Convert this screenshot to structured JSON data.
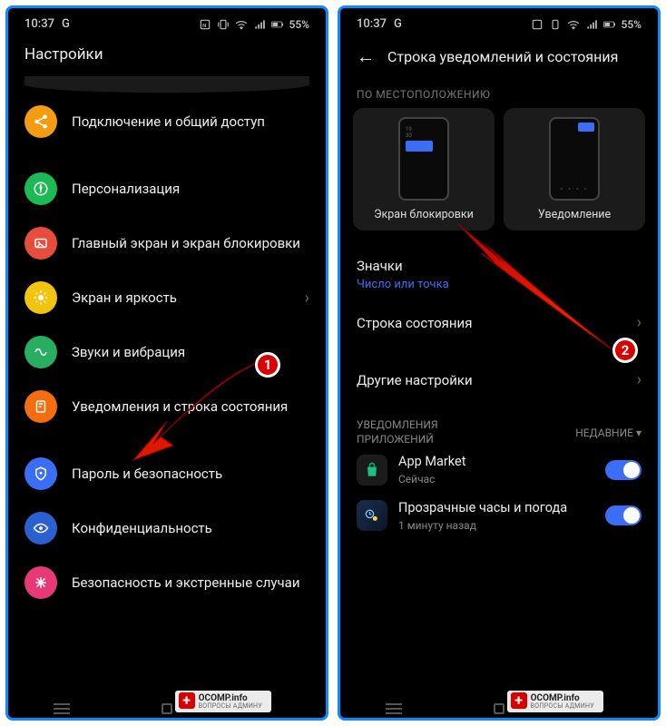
{
  "status": {
    "time": "10:37",
    "assistant": "G",
    "battery": "55%"
  },
  "left": {
    "title": "Настройки",
    "items": [
      {
        "icon": "share",
        "color": "c-orange",
        "label": "Подключение и общий доступ"
      },
      {
        "icon": "compass",
        "color": "c-green",
        "label": "Персонализация"
      },
      {
        "icon": "image",
        "color": "c-red",
        "label": "Главный экран и экран блокировки"
      },
      {
        "icon": "sun",
        "color": "c-yellow",
        "label": "Экран и яркость"
      },
      {
        "icon": "wave",
        "color": "c-dgreen",
        "label": "Звуки и вибрация"
      },
      {
        "icon": "notif",
        "color": "c-orng2",
        "label": "Уведомления и строка состояния"
      },
      {
        "icon": "shield",
        "color": "c-blue",
        "label": "Пароль и безопасность"
      },
      {
        "icon": "eye",
        "color": "c-dblue",
        "label": "Конфиденциальность"
      },
      {
        "icon": "aid",
        "color": "c-pink",
        "label": "Безопасность и экстренные случаи"
      }
    ]
  },
  "right": {
    "title": "Строка уведомлений и состояния",
    "position_header": "ПО МЕСТОПОЛОЖЕНИЮ",
    "card_lock": "Экран блокировки",
    "card_notif": "Уведомление",
    "icons_title": "Значки",
    "icons_sub": "Число или точка",
    "status_line": "Строка состояния",
    "other": "Другие настройки",
    "apps_header": "УВЕДОМЛЕНИЯ ПРИЛОЖЕНИЙ",
    "recent": "НЕДАВНИЕ",
    "apps": [
      {
        "name": "App Market",
        "time": "Сейчас"
      },
      {
        "name": "Прозрачные часы и погода",
        "time": "1 минуту назад"
      }
    ]
  },
  "annotations": {
    "badge1": "1",
    "badge2": "2"
  },
  "watermark": {
    "main": "OCOMP.info",
    "sub": "ВОПРОСЫ АДМИНУ"
  }
}
